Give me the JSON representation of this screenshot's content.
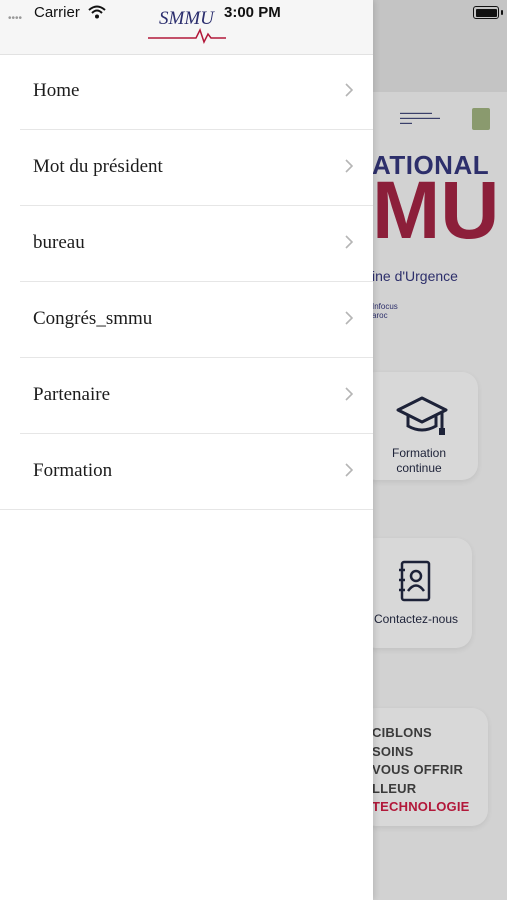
{
  "status_bar": {
    "carrier": "Carrier",
    "time": "3:00 PM",
    "signal_dots": "••••"
  },
  "drawer": {
    "logo_text": "SMMU",
    "items": [
      {
        "label": "Home"
      },
      {
        "label": "Mot du président"
      },
      {
        "label": "bureau"
      },
      {
        "label": "Congrés_smmu"
      },
      {
        "label": "Partenaire"
      },
      {
        "label": "Formation"
      }
    ]
  },
  "background": {
    "banner_title": "ATIONAL",
    "banner_big": "MU",
    "banner_subtitle": "ine d'Urgence",
    "banner_small1": "Infocus",
    "banner_small2": "aroc",
    "cards": [
      {
        "label": "Formation continue",
        "icon": "graduation-cap-icon"
      },
      {
        "label": "Contactez-nous",
        "icon": "contact-book-icon"
      }
    ],
    "promo_lines": [
      "CIBLONS",
      "SOINS",
      "VOUS OFFRIR",
      "LLEUR"
    ],
    "promo_highlight": "TECHNOLOGIE"
  },
  "colors": {
    "brand_blue": "#2d2f6b",
    "brand_red": "#8c1f3a",
    "highlight_red": "#b2183a"
  }
}
